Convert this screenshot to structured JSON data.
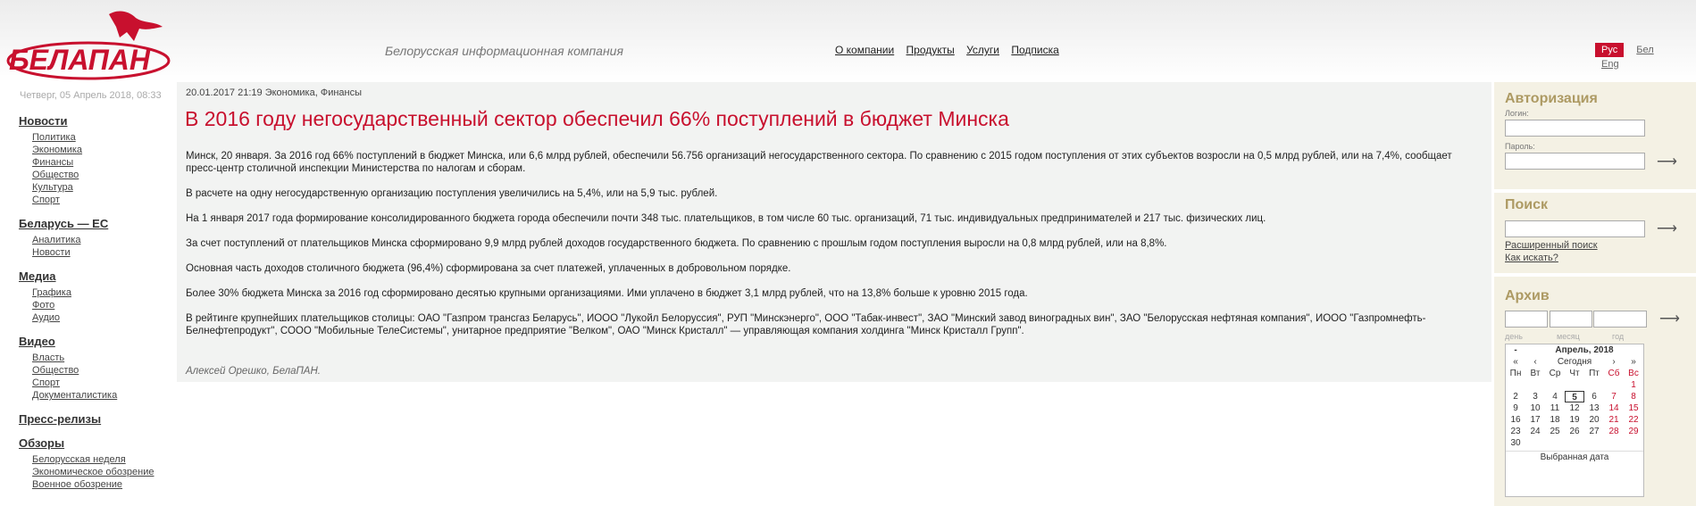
{
  "header": {
    "logo_text": "БЕЛАПАН",
    "tagline": "Белорусская информационная компания",
    "nav": [
      "О компании",
      "Продукты",
      "Услуги",
      "Подписка"
    ],
    "languages": [
      "Рус",
      "Бел",
      "Eng"
    ],
    "active_language": "Рус",
    "colors": {
      "brand": "#c8102e",
      "accent": "#ad9a63"
    }
  },
  "date_line": "Четверг, 05 Апрель 2018, 08:33",
  "leftnav": [
    {
      "title": "Новости",
      "items": [
        "Политика",
        "Экономика",
        "Финансы",
        "Общество",
        "Культура",
        "Спорт"
      ]
    },
    {
      "title": "Беларусь — ЕС",
      "items": [
        "Аналитика",
        "Новости"
      ]
    },
    {
      "title": "Медиа",
      "items": [
        "Графика",
        "Фото",
        "Аудио"
      ]
    },
    {
      "title": "Видео",
      "items": [
        "Власть",
        "Общество",
        "Спорт",
        "Документалистика"
      ]
    },
    {
      "title": "Пресс-релизы",
      "items": []
    },
    {
      "title": "Обзоры",
      "items": [
        "Белорусская неделя",
        "Экономическое обозрение",
        "Военное обозрение"
      ]
    }
  ],
  "article": {
    "meta": "20.01.2017 21:19 Экономика, Финансы",
    "title": "В 2016 году негосударственный сектор обеспечил 66% поступлений в бюджет Минска",
    "paragraphs": [
      "Минск, 20 января. За 2016 год 66% поступлений в бюджет Минска, или 6,6 млрд рублей, обеспечили 56.756 организаций негосударственного сектора. По сравнению с 2015 годом поступления от этих субъектов возросли на 0,5 млрд рублей, или на 7,4%, сообщает пресс-центр столичной инспекции Министерства по налогам и сборам.",
      "В расчете на одну негосударственную организацию поступления увеличились на 5,4%, или на 5,9 тыс. рублей.",
      "На 1 января 2017 года формирование консолидированного бюджета города обеспечили почти 348 тыс. плательщиков, в том числе 60 тыс. организаций, 71 тыс. индивидуальных предпринимателей и 217 тыс. физических лиц.",
      "За счет поступлений от плательщиков Минска сформировано 9,9 млрд рублей доходов государственного бюджета. По сравнению с прошлым годом поступления выросли на 0,8 млрд рублей, или на 8,8%.",
      "Основная часть доходов столичного бюджета (96,4%) сформирована за счет платежей, уплаченных в добровольном порядке.",
      "Более 30% бюджета Минска за 2016 год сформировано десятью крупными организациями. Ими уплачено в бюджет 3,1 млрд рублей, что на 13,8% больше к уровню 2015 года.",
      "В рейтинге крупнейших плательщиков столицы: ОАО \"Газпром трансгаз Беларусь\", ИООО \"Лукойл Белоруссия\", РУП \"Минскэнерго\", ООО \"Табак-инвест\", ЗАО \"Минский завод виноградных вин\", ЗАО \"Белорусская нефтяная компания\", ИООО \"Газпромнефть-Белнефтепродукт\", СООО \"Мобильные ТелеСистемы\", унитарное предприятие \"Велком\", ОАО \"Минск Кристалл\" — управляющая компания холдинга \"Минск Кристалл Групп\"."
    ],
    "author": "Алексей Орешко, БелаПАН."
  },
  "auth": {
    "title": "Авторизация",
    "login_label": "Логин:",
    "password_label": "Пароль:"
  },
  "search": {
    "title": "Поиск",
    "advanced": "Расширенный поиск",
    "how": "Как искать?"
  },
  "archive": {
    "title": "Архив",
    "labels": [
      "день",
      "месяц",
      "год"
    ],
    "calendar": {
      "prev_year": "-",
      "month_label": "Апрель, 2018",
      "nav": [
        "«",
        "‹",
        "Сегодня",
        "›",
        "»"
      ],
      "weekdays": [
        "Пн",
        "Вт",
        "Ср",
        "Чт",
        "Пт",
        "Сб",
        "Вс"
      ],
      "weeks": [
        [
          "",
          "",
          "",
          "",
          "",
          "",
          "1"
        ],
        [
          "2",
          "3",
          "4",
          "5",
          "6",
          "7",
          "8"
        ],
        [
          "9",
          "10",
          "11",
          "12",
          "13",
          "14",
          "15"
        ],
        [
          "16",
          "17",
          "18",
          "19",
          "20",
          "21",
          "22"
        ],
        [
          "23",
          "24",
          "25",
          "26",
          "27",
          "28",
          "29"
        ],
        [
          "30",
          "",
          "",
          "",
          "",
          "",
          ""
        ]
      ],
      "today": "5",
      "footer": "Выбранная дата"
    }
  }
}
